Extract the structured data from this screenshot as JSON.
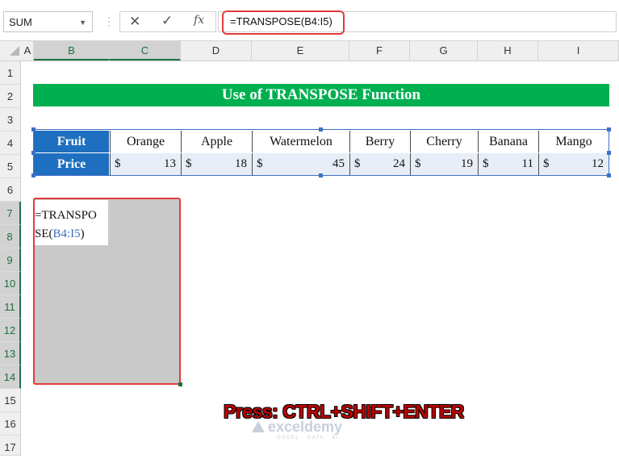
{
  "formula_bar": {
    "name_box": "SUM",
    "formula": "=TRANSPOSE(B4:I5)",
    "fx": "fx",
    "cancel": "✕",
    "enter": "✓"
  },
  "columns": [
    "A",
    "B",
    "C",
    "D",
    "E",
    "F",
    "G",
    "H",
    "I"
  ],
  "rows": [
    "1",
    "2",
    "3",
    "4",
    "5",
    "6",
    "7",
    "8",
    "9",
    "10",
    "11",
    "12",
    "13",
    "14",
    "15",
    "16",
    "17"
  ],
  "title": "Use of TRANSPOSE Function",
  "table": {
    "fruit_label": "Fruit",
    "price_label": "Price",
    "currency": "$",
    "fruits": [
      "Orange",
      "Apple",
      "Watermelon",
      "Berry",
      "Cherry",
      "Banana",
      "Mango"
    ],
    "prices": [
      "13",
      "18",
      "45",
      "24",
      "19",
      "11",
      "12"
    ]
  },
  "edit_cell": {
    "line1": "=TRANSPO",
    "line2_prefix": "SE(",
    "line2_ref": "B4:I5",
    "line2_suffix": ")"
  },
  "annotation": "Press: CTRL+SHIFT+ENTER",
  "watermark": {
    "name": "exceldemy",
    "tagline": "EXCEL · DATA · BI"
  },
  "colors": {
    "banner": "#00b050",
    "table_header": "#1f6fc0",
    "highlight": "#e33b3b",
    "selected_header": "#217346"
  }
}
